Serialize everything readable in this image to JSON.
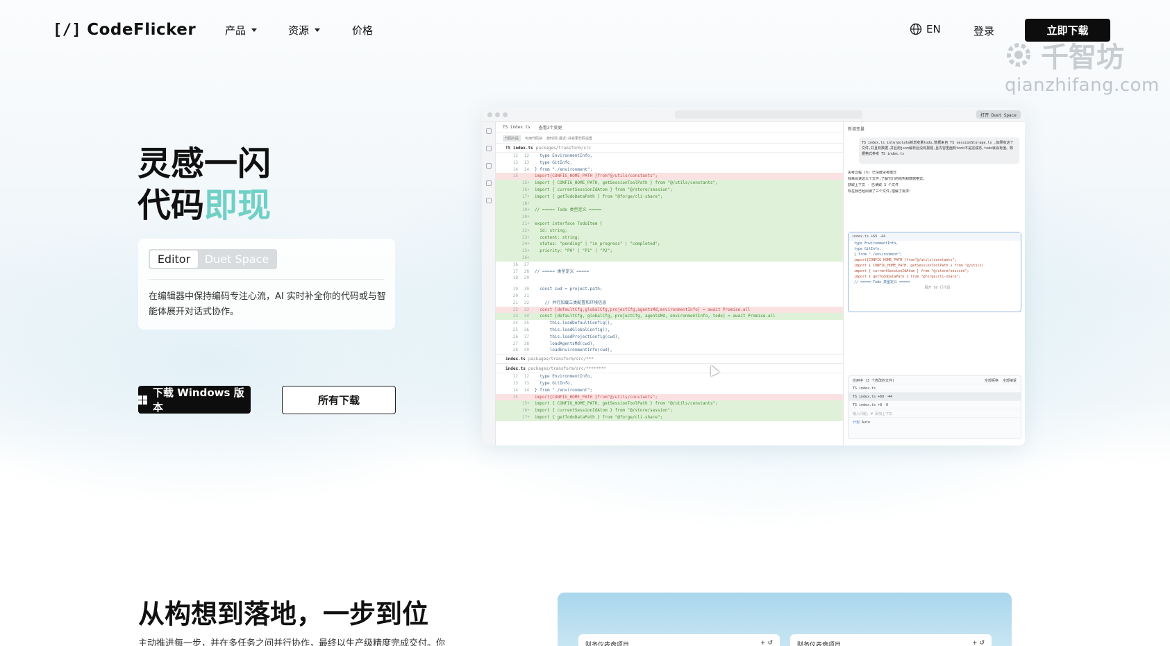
{
  "nav": {
    "logo_bracket": "[/]",
    "logo_text": "CodeFlicker",
    "menu": [
      {
        "label": "产品",
        "has_dropdown": true
      },
      {
        "label": "资源",
        "has_dropdown": true
      },
      {
        "label": "价格",
        "has_dropdown": false
      }
    ],
    "lang": "EN",
    "login": "登录",
    "cta": "立即下载"
  },
  "watermark": {
    "text": "千智坊",
    "url": "qianzhifang.com"
  },
  "hero": {
    "title_line1": "灵感一闪",
    "title_line2_plain": "代码",
    "title_line2_accent": "即现",
    "accent_color": "#6fd0c6",
    "segment": {
      "active": "Editor",
      "inactive": "Duet Space"
    },
    "description": "在编辑器中保持编码专注心流，AI 实时补全你的代码或与智能体展开对话式协作。",
    "btn_windows": "下载 Windows 版本",
    "btn_all": "所有下载"
  },
  "screenshot": {
    "tab1": "TS index.ts",
    "tab2": "查看3个变更",
    "duet_button": "打开 Duet Space",
    "sub_tabs": [
      "代码片段",
      "可用代码块",
      "按时间(最近)并变更代码设置"
    ],
    "file1": {
      "name": "TS index.ts",
      "path": "packages/transform/src"
    },
    "file2": {
      "name": "index.ts",
      "path": "packages/transform/src/***"
    },
    "file3": {
      "name": "index.ts",
      "path": "packages/transform/src/********"
    },
    "code_lines": [
      {
        "n1": "12",
        "n2": "12",
        "type": "ctx",
        "text": "  type EnvironmentInfo,"
      },
      {
        "n1": "13",
        "n2": "13",
        "type": "ctx",
        "text": "  type GitInfo,"
      },
      {
        "n1": "14",
        "n2": "14",
        "type": "ctx",
        "text": "} from \"./environment\";"
      },
      {
        "n1": "15",
        "n2": "",
        "type": "del",
        "text": "import{CONFIG_HOME_PATH }from\"@/utils/constants\";"
      },
      {
        "n1": "",
        "n2": "15+",
        "type": "add",
        "text": "import { CONFIG_HOME_PATH, getSessionToolPath } from \"@/utils/constants\";"
      },
      {
        "n1": "",
        "n2": "16+",
        "type": "add",
        "text": "import { currentSessionIdAtom } from \"@/store/session\";"
      },
      {
        "n1": "",
        "n2": "17+",
        "type": "add",
        "text": "import { getTodoDataPath } from \"@forge/cli-share\";"
      },
      {
        "n1": "",
        "n2": "18+",
        "type": "add",
        "text": ""
      },
      {
        "n1": "",
        "n2": "19+",
        "type": "add",
        "text": "// ===== Todo 类型定义 ====="
      },
      {
        "n1": "",
        "n2": "20+",
        "type": "add",
        "text": ""
      },
      {
        "n1": "",
        "n2": "21+",
        "type": "add",
        "text": "export interface TodoItem {"
      },
      {
        "n1": "",
        "n2": "22+",
        "type": "add",
        "text": "  id: string;"
      },
      {
        "n1": "",
        "n2": "23+",
        "type": "add",
        "text": "  content: string;"
      },
      {
        "n1": "",
        "n2": "24+",
        "type": "add",
        "text": "  status: \"pending\" | \"in_progress\" | \"completed\";"
      },
      {
        "n1": "",
        "n2": "25+",
        "type": "add",
        "text": "  priority: \"P0\" | \"P1\" | \"P2\";"
      },
      {
        "n1": "",
        "n2": "26+",
        "type": "add",
        "text": ""
      },
      {
        "n1": "16",
        "n2": "27",
        "type": "ctx",
        "text": ""
      },
      {
        "n1": "17",
        "n2": "28",
        "type": "ctx",
        "text": "// ===== 类型定义 ====="
      },
      {
        "n1": "18",
        "n2": "29",
        "type": "ctx",
        "text": ""
      }
    ],
    "code_lines_b": [
      {
        "n1": "19",
        "n2": "30",
        "type": "ctx",
        "text": "  const cwd = project.path;"
      },
      {
        "n1": "20",
        "n2": "31",
        "type": "ctx",
        "text": ""
      },
      {
        "n1": "21",
        "n2": "32",
        "type": "ctx",
        "text": "    // 并行加载三类配置和环境信息"
      },
      {
        "n1": "22",
        "n2": "33",
        "type": "del",
        "text": "  const [defaultCfg,globalCfg,projectCfg,agentsMd,environmentInfo] = await Promise.all"
      },
      {
        "n1": "23",
        "n2": "34",
        "type": "add",
        "text": "  const [defaultCfg, globalCfg, projectCfg, agentsMd, environmentInfo, todo] = await Promise.all"
      },
      {
        "n1": "24",
        "n2": "35",
        "type": "ctx",
        "text": "      this.loadDefaultConfig(),"
      },
      {
        "n1": "25",
        "n2": "36",
        "type": "ctx",
        "text": "      this.loadGlobalConfig(),"
      },
      {
        "n1": "26",
        "n2": "37",
        "type": "ctx",
        "text": "      this.loadProjectConfig(cwd),"
      },
      {
        "n1": "27",
        "n2": "38",
        "type": "ctx",
        "text": "      loadAgentsMd(cwd),"
      },
      {
        "n1": "28",
        "n2": "39",
        "type": "ctx",
        "text": "      loadEnvironmentInfo(cwd),"
      }
    ],
    "code_lines_c": [
      {
        "n1": "12",
        "n2": "12",
        "type": "ctx",
        "text": "  type EnvironmentInfo,"
      },
      {
        "n1": "13",
        "n2": "13",
        "type": "ctx",
        "text": "  type GitInfo,"
      },
      {
        "n1": "14",
        "n2": "14",
        "type": "ctx",
        "text": "} from \"./environment\";"
      },
      {
        "n1": "15",
        "n2": "",
        "type": "del",
        "text": "import{CONFIG_HOME_PATH }from\"@/utils/constants\";"
      },
      {
        "n1": "",
        "n2": "15+",
        "type": "add",
        "text": "import { CONFIG_HOME_PATH, getSessionToolPath } from \"@/utils/constants\";"
      },
      {
        "n1": "",
        "n2": "16+",
        "type": "add",
        "text": "import { currentSessionIdAtom } from \"@/store/session\";"
      },
      {
        "n1": "",
        "n2": "17+",
        "type": "add",
        "text": "import { getTodoDataPath } from \"@forge/cli-share\";"
      }
    ],
    "chat": {
      "header": "新增变量",
      "bubble": "TS index.ts interpolate新增变量todo,数据来自 TS sessionStorage.ts ,如果有这个文件,并且有数据,并且用json解析后没有报错,且内容里面有todo不是完成态,todo就会有值。数据格式参考 TS index.ts",
      "line1": "思考过程 (%) 已深度思考模式",
      "line2": "我来阅读这三个文件,了解它们的结构和数据格式。",
      "line3": "获取上下文 · 已读取 3 个文件",
      "line4": "现在我已经阅读了三个文件,理解了需求:",
      "card_header": "index.ts +69 -44",
      "card_lines": [
        "  type EnvironmentInfo,",
        "  type GitInfo,",
        "} from \"./environment\";",
        "import{CONFIG_HOME_PATH }from\"@/utils/constants\";",
        "import { CONFIG_HOME_PATH, getSessionToolPath } from \"@/utils/",
        "import { currentSessionIdAtom } from \"@/store/session\";",
        "import { getTodoDataPath } from \"@forge/cli-share\";",
        "",
        "// ===== Todo 类型定义 ====="
      ],
      "card_footer": "展开 80 行代码",
      "pending_header": "应用中 (3 个修改的文件)",
      "pending_reject": "全部拒绝",
      "pending_accept": "全部接受",
      "pending_files": [
        "TS index.ts",
        "TS index.ts +69 -44",
        "TS index.ts +8 -0"
      ],
      "input_placeholder": "输入问题, # 添加上下文",
      "mode": "计划",
      "model": "Auto"
    }
  },
  "section2": {
    "title": "从构想到落地，一步到位",
    "desc": "主动推进每一步，并在多任务之间并行协作，最终以生产级精度完成交付。你",
    "panel_left": "财务仪表盘项目",
    "panel_right": "财务仪表盘项目"
  }
}
